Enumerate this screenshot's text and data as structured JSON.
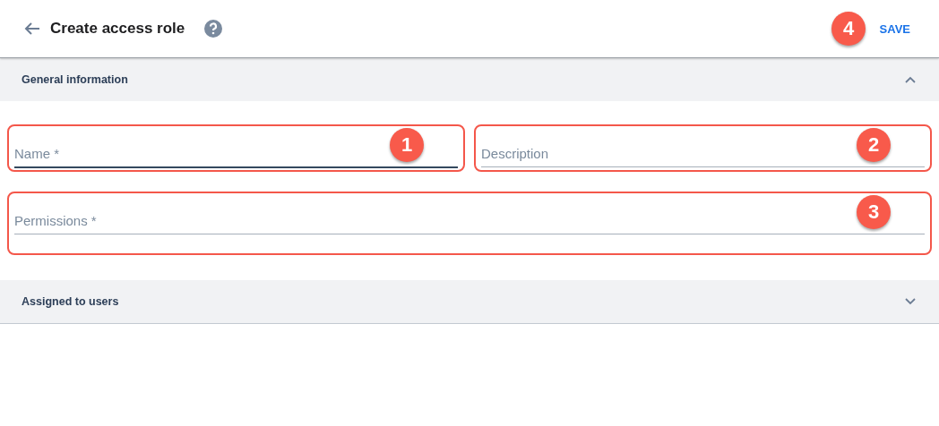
{
  "header": {
    "title": "Create access role",
    "save_button": "SAVE",
    "save_callout": "4"
  },
  "sections": [
    {
      "title": "General information",
      "expanded": true,
      "rows": [
        [
          {
            "placeholder": "Name *",
            "focused": true,
            "highlighted": true,
            "callout": "1"
          },
          {
            "placeholder": "Description",
            "focused": false,
            "highlighted": true,
            "callout": "2"
          }
        ],
        [
          {
            "placeholder": "Permissions *",
            "focused": false,
            "highlighted": true,
            "callout": "3"
          }
        ]
      ]
    },
    {
      "title": "Assigned to users",
      "expanded": false
    }
  ]
}
